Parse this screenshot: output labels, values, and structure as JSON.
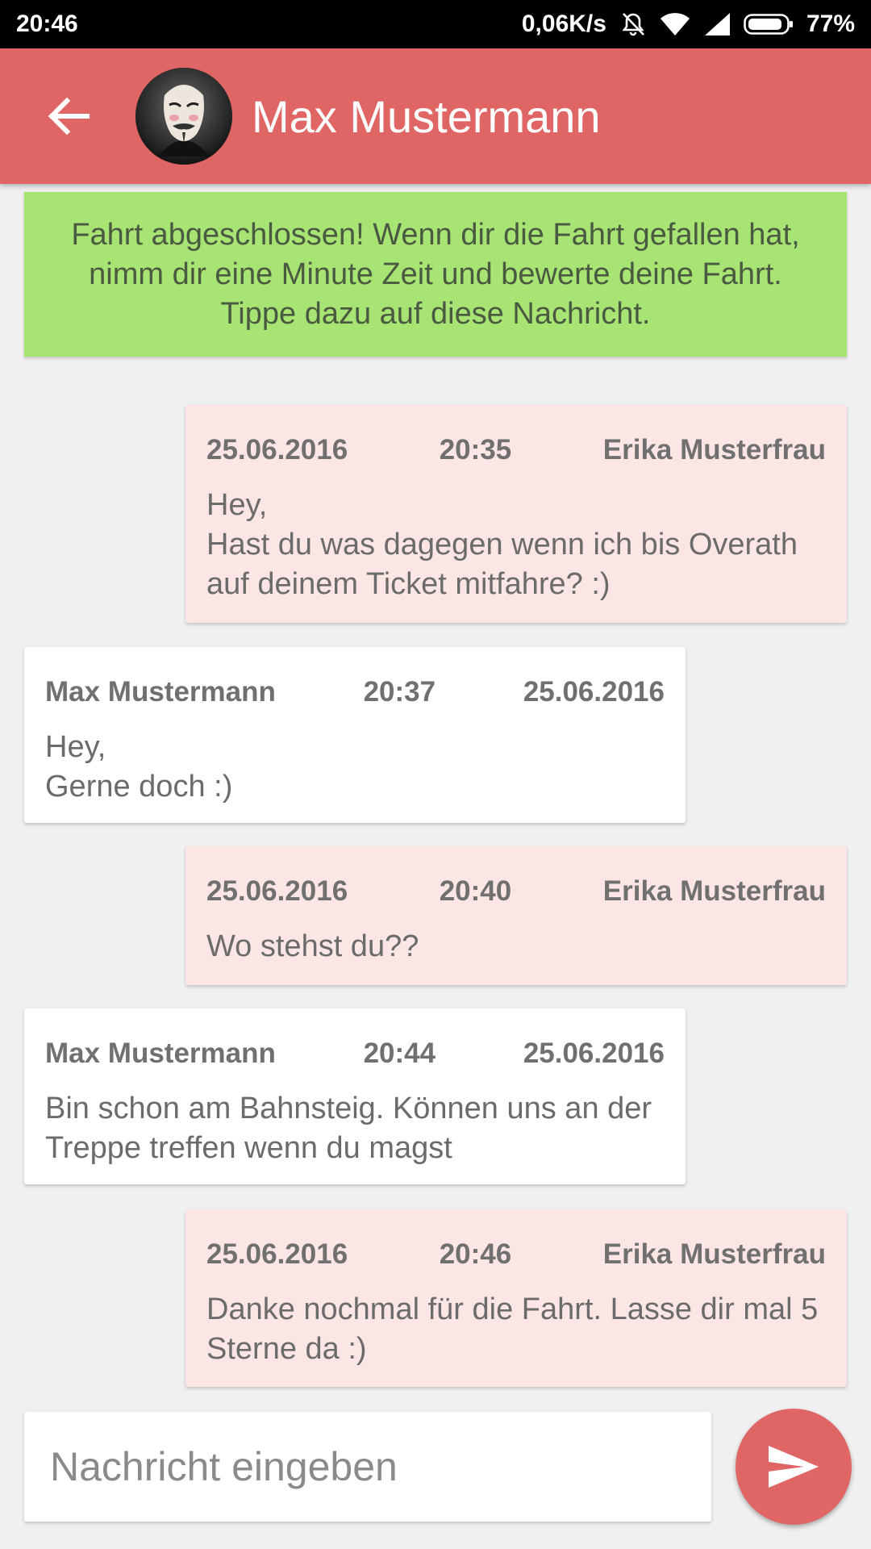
{
  "status_bar": {
    "time": "20:46",
    "speed": "0,06K/s",
    "battery": "77%",
    "icons": [
      "mute-vibrate-icon",
      "wifi-icon",
      "signal-icon",
      "battery-icon"
    ]
  },
  "app_bar": {
    "title": "Max Mustermann",
    "back_icon": "arrow-back-icon",
    "avatar": "contact-avatar"
  },
  "banner": {
    "text": "Fahrt abgeschlossen! Wenn dir die Fahrt gefallen hat, nimm dir eine Minute Zeit und bewerte deine Fahrt. Tippe dazu auf diese Nachricht."
  },
  "messages": [
    {
      "direction": "out",
      "date": "25.06.2016",
      "time": "20:35",
      "sender": "Erika Musterfrau",
      "text": "Hey,\nHast du was dagegen wenn ich bis Overath auf deinem Ticket mitfahre? :)"
    },
    {
      "direction": "in",
      "sender": "Max Mustermann",
      "time": "20:37",
      "date": "25.06.2016",
      "text": "Hey,\nGerne doch :)"
    },
    {
      "direction": "out",
      "date": "25.06.2016",
      "time": "20:40",
      "sender": "Erika Musterfrau",
      "text": "Wo stehst du??"
    },
    {
      "direction": "in",
      "sender": "Max Mustermann",
      "time": "20:44",
      "date": "25.06.2016",
      "text": "Bin schon am Bahnsteig. Können uns an der Treppe treffen wenn du magst"
    },
    {
      "direction": "out",
      "date": "25.06.2016",
      "time": "20:46",
      "sender": "Erika Musterfrau",
      "text": "Danke nochmal für die Fahrt. Lasse dir mal 5 Sterne da :)"
    }
  ],
  "composer": {
    "placeholder": "Nachricht eingeben",
    "value": "",
    "send_icon": "send-icon"
  },
  "colors": {
    "accent": "#e06666",
    "banner": "#a8e474",
    "outgoing_bubble": "#fbe6e5",
    "incoming_bubble": "#ffffff",
    "background": "#f0f0f0"
  }
}
